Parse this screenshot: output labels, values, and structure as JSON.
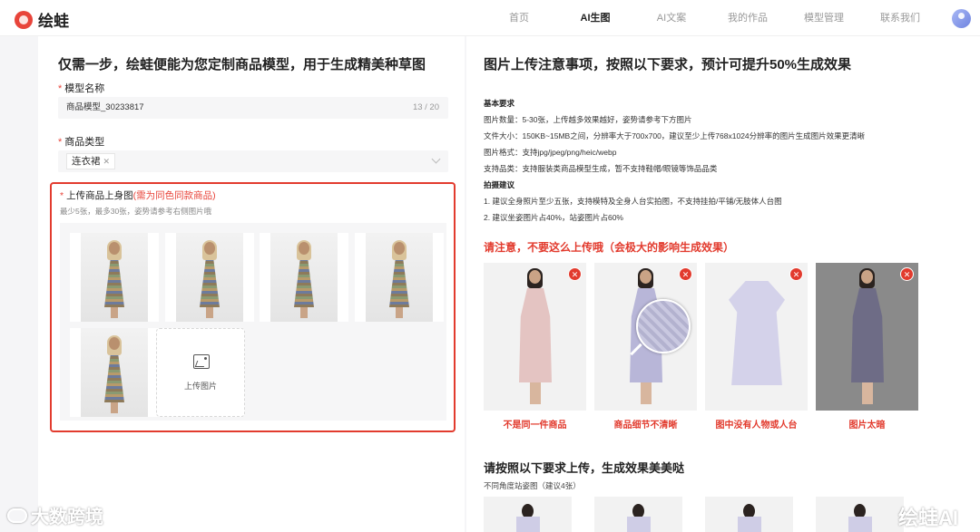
{
  "app": {
    "logo_text": "绘蛙",
    "brand_color": "#e8443a"
  },
  "nav": {
    "items": [
      {
        "label": "首页"
      },
      {
        "label": "AI生图"
      },
      {
        "label": "AI文案"
      },
      {
        "label": "我的作品"
      },
      {
        "label": "模型管理"
      },
      {
        "label": "联系我们"
      }
    ],
    "active": "AI生图"
  },
  "left": {
    "title": "仅需一步，绘蛙便能为您定制商品模型，用于生成精美种草图",
    "model_name": {
      "label": "模型名称",
      "value": "商品模型_30233817",
      "counter": "13 / 20"
    },
    "category": {
      "label": "商品类型",
      "selected": "连衣裙"
    },
    "upload": {
      "label": "上传商品上身图",
      "label_hint": "(需为同色同款商品)",
      "sub": "最少5张，最多30张，姿势请参考右侧图片哦",
      "button_label": "上传图片",
      "image_count": 5
    }
  },
  "right": {
    "title": "图片上传注意事项，按照以下要求，预计可提升50%生成效果",
    "requirements": {
      "basic_head": "基本要求",
      "lines": [
        "图片数量：5-30张，上传越多效果越好，姿势请参考下方图片",
        "文件大小：150KB~15MB之间，分辨率大于700x700，建议至少上传768x1024分辨率的图片生成图片效果更清晰",
        "图片格式：支持jpg/jpeg/png/heic/webp",
        "支持品类：支持服装类商品模型生成，暂不支持鞋帽/眼镜等饰品品类"
      ],
      "shooting_head": "拍摄建议",
      "shooting_lines": [
        "1. 建议全身照片至少五张，支持模特及全身人台实拍图，不支持挂拍/平铺/无肢体人台图",
        "2. 建议坐姿图片占40%，站姿图片占60%"
      ]
    },
    "warning_title": "请注意，不要这么上传哦（会极大的影响生成效果）",
    "bad_examples": [
      {
        "caption": "不是同一件商品"
      },
      {
        "caption": "商品细节不清晰"
      },
      {
        "caption": "图中没有人物或人台"
      },
      {
        "caption": "图片太暗"
      }
    ],
    "good_title": "请按照以下要求上传，生成效果美美哒",
    "good_sub": "不同角度站姿图（建议4张）"
  },
  "watermarks": {
    "left": "大数跨境",
    "right": "绘蛙AI"
  }
}
